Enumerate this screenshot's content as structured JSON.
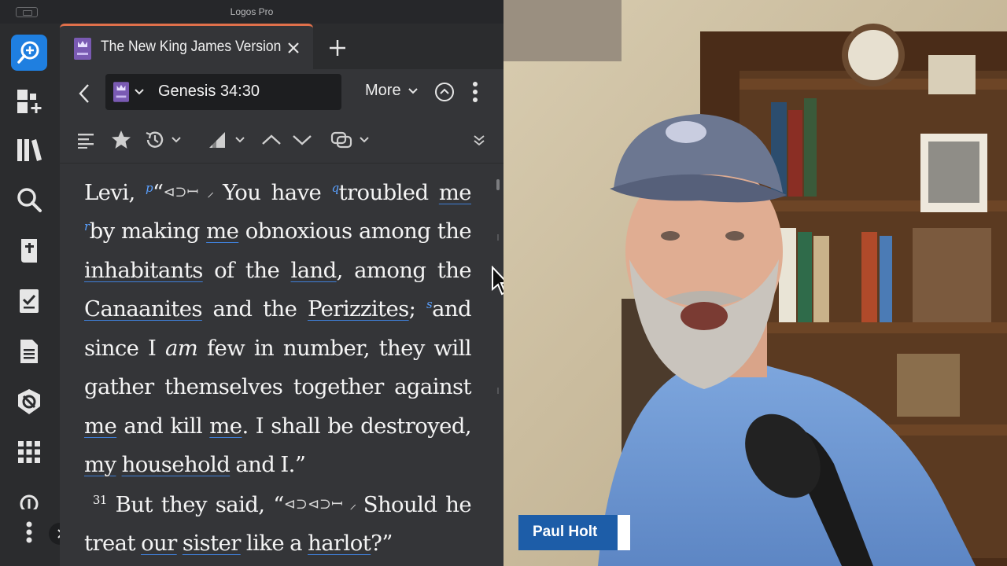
{
  "window": {
    "app_title": "Logos Pro"
  },
  "tab": {
    "title": "The New King James Version",
    "book_badge": "NKJV"
  },
  "navigation": {
    "reference": "Genesis 34:30",
    "more_label": "More"
  },
  "passage": {
    "line1_a": "Levi, ",
    "fn_p": "p",
    "line1_b": "“",
    "line1_sym1": "⊲⊃ꟷ ⸝ ",
    "line1_c": "You have ",
    "fn_q": "q",
    "line1_d": "troubled ",
    "w_me1": "me",
    "fn_r": "r",
    "line2_a": "by making ",
    "w_me2": "me",
    "line2_b": " obnoxious among the ",
    "w_inhabitants": "inhabitants",
    "line2_c": " of the ",
    "w_land": "land",
    "line2_d": ", among the ",
    "w_canaanites": "Canaanites",
    "line2_e": " and the ",
    "w_perizzites": "Perizzites",
    "line2_f": "; ",
    "fn_s": "s",
    "line3_a": "and since I ",
    "w_am": "am",
    "line3_b": " few in number, they will gather themselves together against ",
    "w_me3": "me",
    "line3_c": " and kill ",
    "w_me4": "me",
    "line3_d": ". I shall be destroyed, ",
    "w_my": "my",
    "line3_e": " ",
    "w_household": "household",
    "line3_f": " and I.”",
    "verse_num": "31",
    "line4_a": " But they said, “",
    "line4_sym": "⊲⊃⊲⊃ꟷ ⸝ ",
    "line4_b": "Should he treat ",
    "w_our": "our",
    "line4_c": " ",
    "w_sister": "sister",
    "line4_d": " like a ",
    "w_harlot": "harlot",
    "line4_e": "?”"
  },
  "presenter": {
    "name": "Paul Holt"
  },
  "colors": {
    "accent_blue": "#1f7fe0",
    "tab_accent": "#e0704b",
    "nameplate": "#1d5da8",
    "link_underline": "#3f7fd8"
  }
}
